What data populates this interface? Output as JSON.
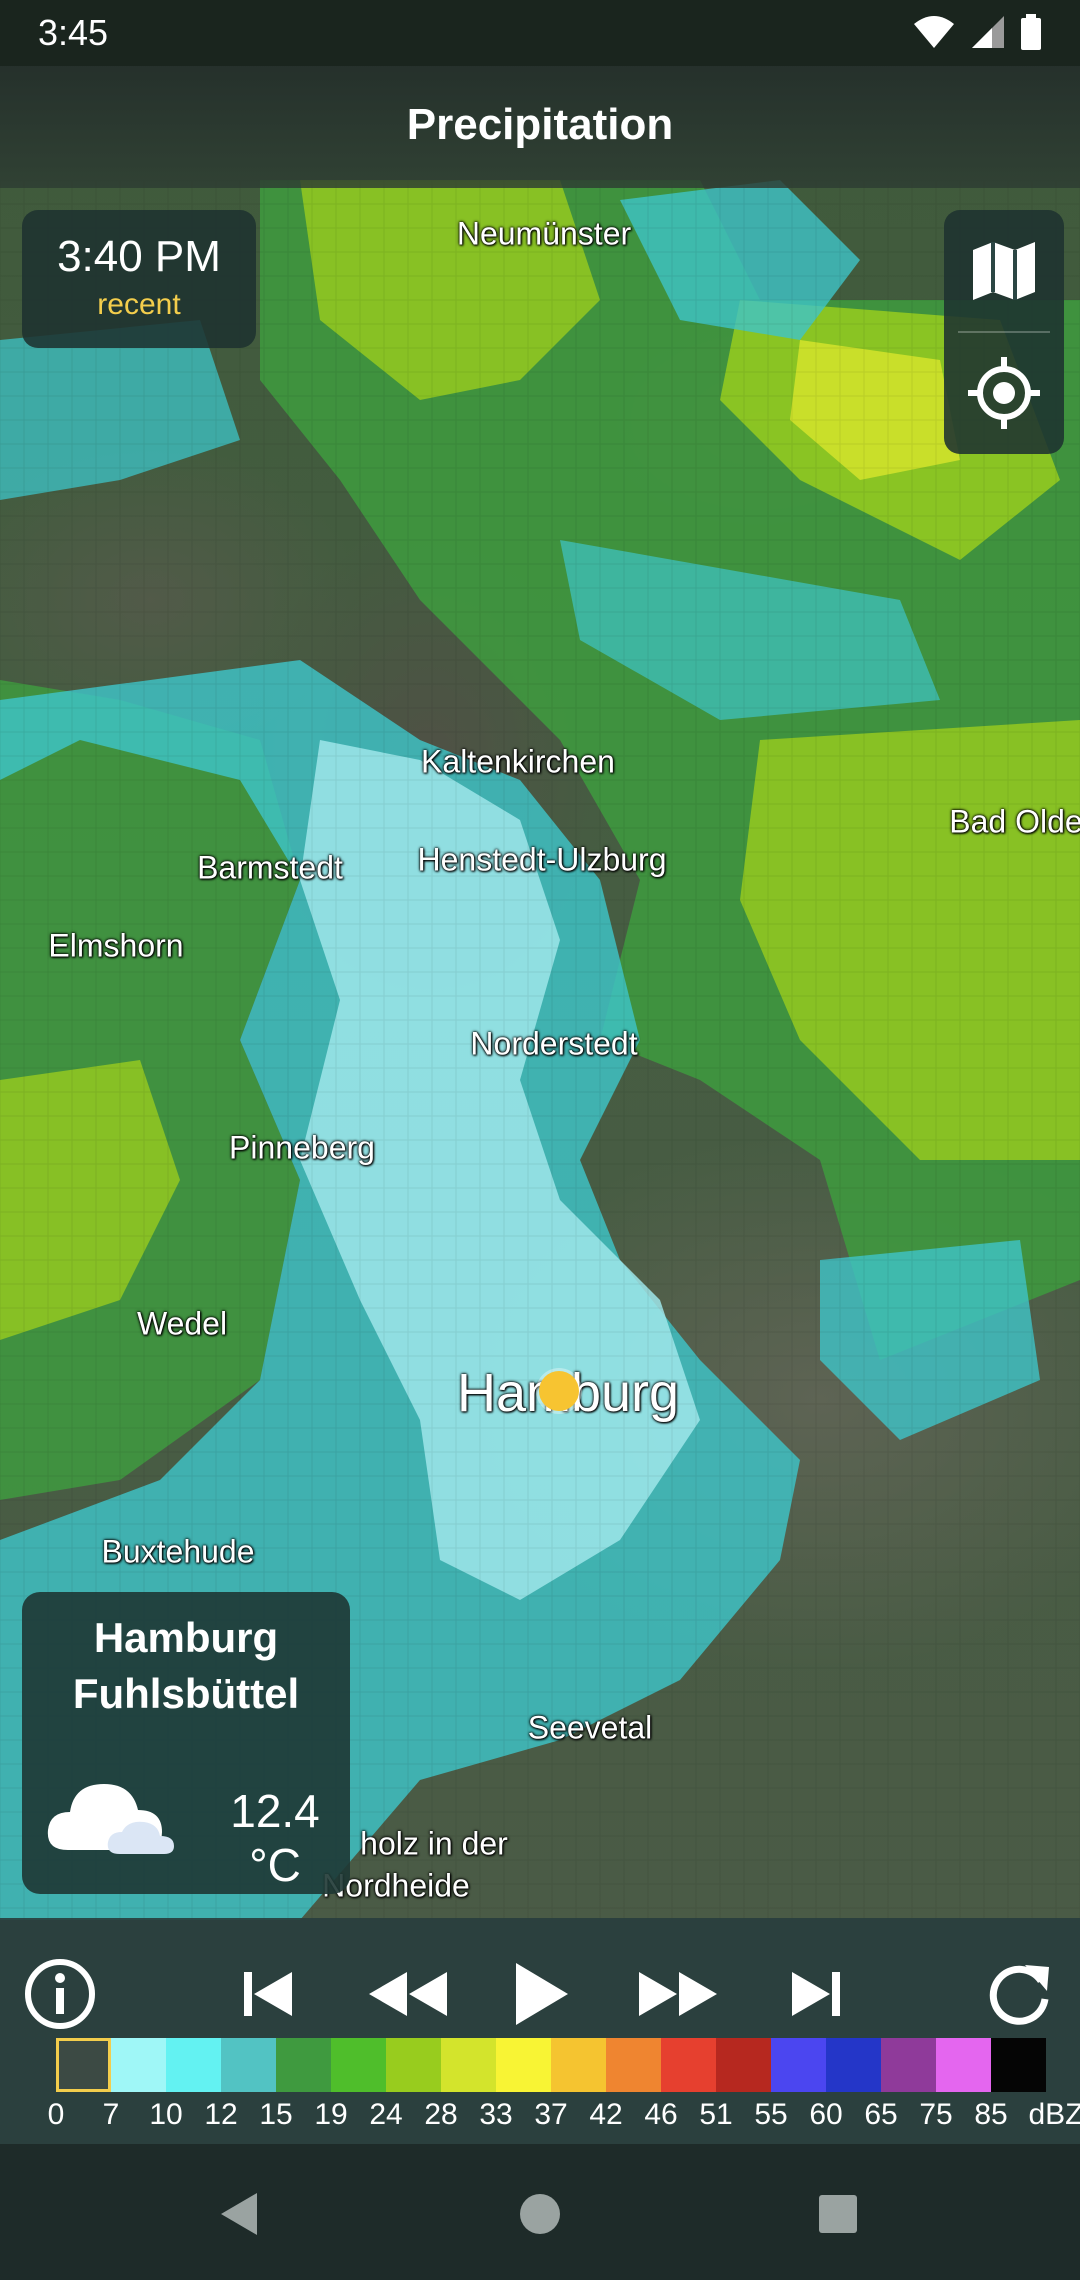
{
  "status_bar": {
    "time": "3:45"
  },
  "app_bar": {
    "title": "Precipitation"
  },
  "time_card": {
    "time": "3:40 PM",
    "status": "recent"
  },
  "map_controls": {
    "layers_icon": "map-icon",
    "locate_icon": "my-location-icon"
  },
  "map": {
    "places": [
      {
        "id": "neumuenster",
        "name": "Neumünster"
      },
      {
        "id": "kaltenkirchen",
        "name": "Kaltenkirchen"
      },
      {
        "id": "bad-oldesloe",
        "name": "Bad Olde"
      },
      {
        "id": "barmstedt",
        "name": "Barmstedt"
      },
      {
        "id": "henstedt",
        "name": "Henstedt-Ulzburg"
      },
      {
        "id": "elmshorn",
        "name": "Elmshorn"
      },
      {
        "id": "norderstedt",
        "name": "Norderstedt"
      },
      {
        "id": "pinneberg",
        "name": "Pinneberg"
      },
      {
        "id": "wedel",
        "name": "Wedel"
      },
      {
        "id": "hamburg",
        "name": "Hamburg"
      },
      {
        "id": "buxtehude",
        "name": "Buxtehude"
      },
      {
        "id": "seevetal",
        "name": "Seevetal"
      },
      {
        "id": "buchholz-1",
        "name": "holz in der"
      },
      {
        "id": "buchholz-2",
        "name": "Nordheide"
      }
    ]
  },
  "weather_card": {
    "station_line1": "Hamburg",
    "station_line2": "Fuhlsbüttel",
    "temperature": "12.4 °C",
    "icon": "cloudy-icon"
  },
  "player": {
    "buttons": [
      "info-icon",
      "skip-first-icon",
      "rewind-icon",
      "play-icon",
      "fast-forward-icon",
      "skip-last-icon",
      "refresh-icon"
    ]
  },
  "legend": {
    "colors": [
      "#3c4a44",
      "#9ff7f7",
      "#63f2f2",
      "#52c3c3",
      "#3f9a3f",
      "#4fbe2b",
      "#98cc1e",
      "#d3e42c",
      "#f8f434",
      "#f5c430",
      "#ef8530",
      "#e6402f",
      "#b6281f",
      "#4b46f0",
      "#2436c8",
      "#8f3a9a",
      "#e466ef",
      "#050505"
    ],
    "labels": [
      "0",
      "7",
      "10",
      "12",
      "15",
      "19",
      "24",
      "28",
      "33",
      "37",
      "42",
      "46",
      "51",
      "55",
      "60",
      "65",
      "75",
      "85"
    ],
    "unit": "dBZ"
  }
}
